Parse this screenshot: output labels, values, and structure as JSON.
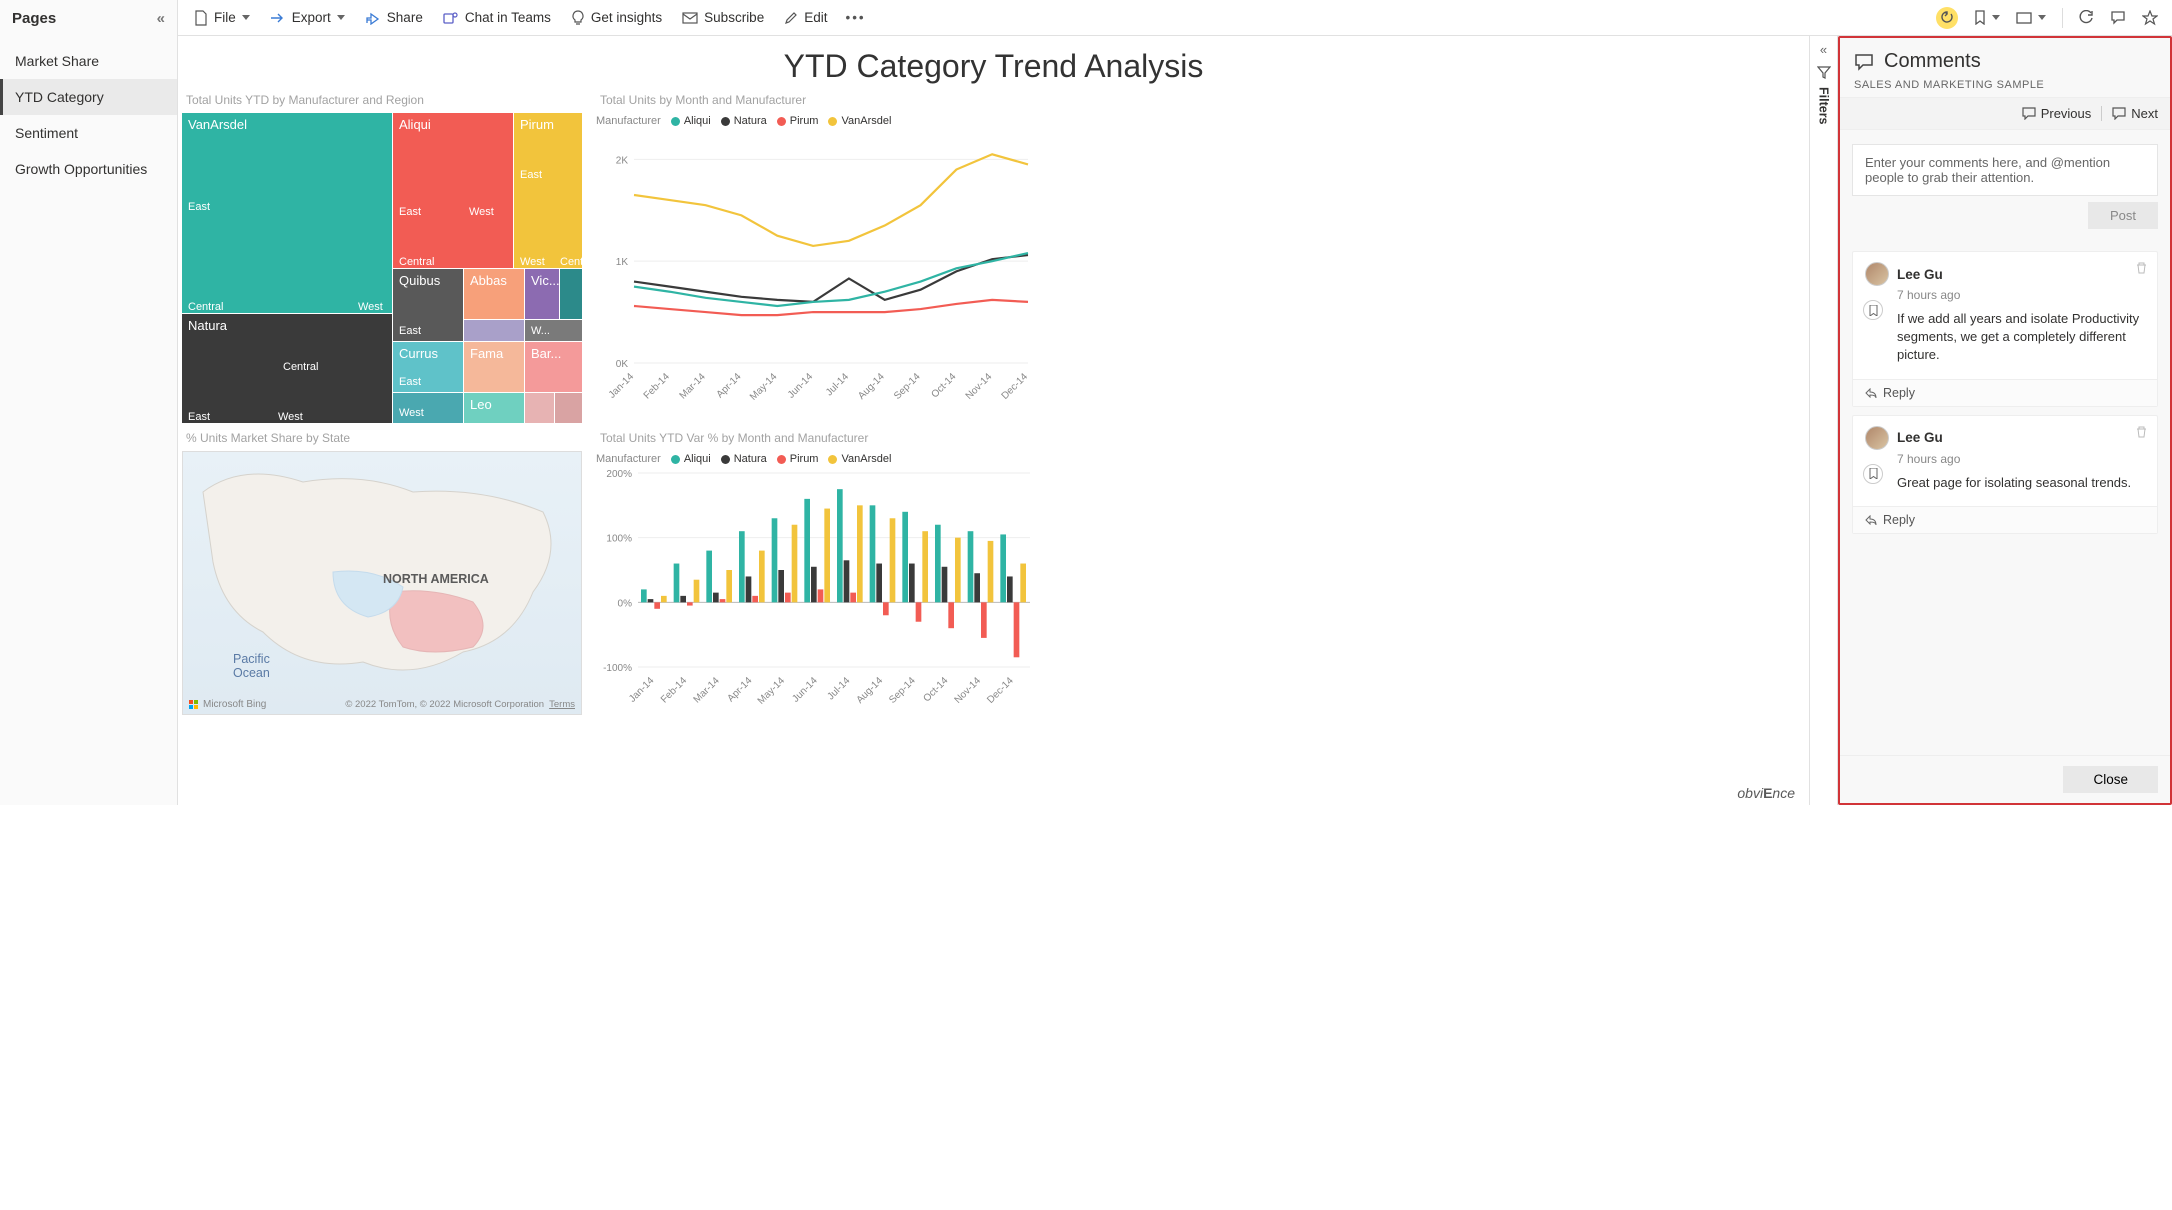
{
  "sidebar": {
    "title": "Pages",
    "items": [
      {
        "label": "Market Share"
      },
      {
        "label": "YTD Category"
      },
      {
        "label": "Sentiment"
      },
      {
        "label": "Growth Opportunities"
      }
    ],
    "active_index": 1
  },
  "toolbar": {
    "file": "File",
    "export": "Export",
    "share": "Share",
    "chat": "Chat in Teams",
    "insights": "Get insights",
    "subscribe": "Subscribe",
    "edit": "Edit"
  },
  "report": {
    "title": "YTD Category Trend Analysis",
    "filters_label": "Filters",
    "brand": "obviEnce",
    "treemap": {
      "title": "Total Units YTD by Manufacturer and Region"
    },
    "line": {
      "title": "Total Units by Month and Manufacturer",
      "legend_label": "Manufacturer"
    },
    "map": {
      "title": "% Units Market Share by State",
      "na_label": "NORTH AMERICA",
      "pacific_label": "Pacific\nOcean",
      "bing": "Microsoft Bing",
      "credits": "© 2022 TomTom, © 2022 Microsoft Corporation",
      "terms": "Terms"
    },
    "bar": {
      "title": "Total Units YTD Var % by Month and Manufacturer",
      "legend_label": "Manufacturer"
    }
  },
  "legend_items": [
    {
      "name": "Aliqui",
      "color": "#2fb4a4"
    },
    {
      "name": "Natura",
      "color": "#3a3a3a"
    },
    {
      "name": "Pirum",
      "color": "#f25c54"
    },
    {
      "name": "VanArsdel",
      "color": "#f2c43c"
    }
  ],
  "comments": {
    "heading": "Comments",
    "subtitle": "SALES AND MARKETING SAMPLE",
    "prev": "Previous",
    "next": "Next",
    "placeholder": "Enter your comments here, and @mention people to grab their attention.",
    "post": "Post",
    "reply": "Reply",
    "close": "Close",
    "items": [
      {
        "user": "Lee Gu",
        "time": "7 hours ago",
        "text": "If we add all years and isolate Productivity segments, we get a completely different picture."
      },
      {
        "user": "Lee Gu",
        "time": "7 hours ago",
        "text": "Great page for isolating seasonal trends."
      }
    ]
  },
  "chart_data": [
    {
      "type": "treemap",
      "title": "Total Units YTD by Manufacturer and Region",
      "nodes": [
        {
          "name": "VanArsdel",
          "color": "#2fb4a4",
          "children": [
            {
              "name": "East",
              "v": 40
            },
            {
              "name": "Central",
              "v": 30
            },
            {
              "name": "West",
              "v": 10
            }
          ]
        },
        {
          "name": "Natura",
          "color": "#3a3a3a",
          "children": [
            {
              "name": "Central",
              "v": 18
            },
            {
              "name": "East",
              "v": 12
            },
            {
              "name": "West",
              "v": 10
            }
          ]
        },
        {
          "name": "Aliqui",
          "color": "#f25c54",
          "children": [
            {
              "name": "East",
              "v": 20
            },
            {
              "name": "West",
              "v": 10
            },
            {
              "name": "Central",
              "v": 14
            }
          ]
        },
        {
          "name": "Pirum",
          "color": "#f2c43c",
          "children": [
            {
              "name": "East",
              "v": 14
            },
            {
              "name": "West",
              "v": 6
            },
            {
              "name": "Cent...",
              "v": 5
            }
          ]
        },
        {
          "name": "Quibus",
          "color": "#595959",
          "children": [
            {
              "name": "East",
              "v": 10
            }
          ]
        },
        {
          "name": "Abbas",
          "color": "#f7a07a",
          "children": [
            {
              "name": "",
              "v": 8
            }
          ]
        },
        {
          "name": "Vic...",
          "color": "#8c6bb1",
          "children": [
            {
              "name": "",
              "v": 5
            }
          ]
        },
        {
          "name": "Currus",
          "color": "#5fc2c9",
          "children": [
            {
              "name": "East",
              "v": 7
            },
            {
              "name": "West",
              "v": 5
            }
          ]
        },
        {
          "name": "Fama",
          "color": "#f5b89a",
          "children": [
            {
              "name": "",
              "v": 6
            }
          ]
        },
        {
          "name": "Bar...",
          "color": "#f49a9a",
          "children": [
            {
              "name": "",
              "v": 5
            }
          ]
        },
        {
          "name": "Leo",
          "color": "#6fd0c0",
          "children": [
            {
              "name": "",
              "v": 5
            }
          ]
        },
        {
          "name": "",
          "color": "#2c8a8a",
          "children": [
            {
              "name": "W...",
              "v": 3
            }
          ]
        }
      ]
    },
    {
      "type": "line",
      "title": "Total Units by Month and Manufacturer",
      "xlabel": "",
      "ylabel": "",
      "ylim": [
        0,
        2200
      ],
      "yticks": [
        0,
        1000,
        2000
      ],
      "ytick_labels": [
        "0K",
        "1K",
        "2K"
      ],
      "categories": [
        "Jan-14",
        "Feb-14",
        "Mar-14",
        "Apr-14",
        "May-14",
        "Jun-14",
        "Jul-14",
        "Aug-14",
        "Sep-14",
        "Oct-14",
        "Nov-14",
        "Dec-14"
      ],
      "series": [
        {
          "name": "VanArsdel",
          "color": "#f2c43c",
          "values": [
            1650,
            1600,
            1550,
            1450,
            1250,
            1150,
            1200,
            1350,
            1550,
            1900,
            2050,
            1950
          ]
        },
        {
          "name": "Natura",
          "color": "#3a3a3a",
          "values": [
            800,
            750,
            700,
            650,
            620,
            600,
            830,
            620,
            720,
            900,
            1020,
            1060
          ]
        },
        {
          "name": "Aliqui",
          "color": "#2fb4a4",
          "values": [
            750,
            700,
            640,
            600,
            560,
            600,
            620,
            700,
            800,
            930,
            1000,
            1080
          ]
        },
        {
          "name": "Pirum",
          "color": "#f25c54",
          "values": [
            560,
            530,
            500,
            470,
            470,
            500,
            500,
            500,
            530,
            580,
            620,
            600
          ]
        }
      ]
    },
    {
      "type": "bar",
      "title": "Total Units YTD Var % by Month and Manufacturer",
      "xlabel": "",
      "ylabel": "",
      "ylim": [
        -100,
        200
      ],
      "yticks": [
        -100,
        0,
        100,
        200
      ],
      "ytick_labels": [
        "-100%",
        "0%",
        "100%",
        "200%"
      ],
      "categories": [
        "Jan-14",
        "Feb-14",
        "Mar-14",
        "Apr-14",
        "May-14",
        "Jun-14",
        "Jul-14",
        "Aug-14",
        "Sep-14",
        "Oct-14",
        "Nov-14",
        "Dec-14"
      ],
      "series": [
        {
          "name": "Aliqui",
          "color": "#2fb4a4",
          "values": [
            20,
            60,
            80,
            110,
            130,
            160,
            175,
            150,
            140,
            120,
            110,
            105
          ]
        },
        {
          "name": "Natura",
          "color": "#3a3a3a",
          "values": [
            5,
            10,
            15,
            40,
            50,
            55,
            65,
            60,
            60,
            55,
            45,
            40
          ]
        },
        {
          "name": "Pirum",
          "color": "#f25c54",
          "values": [
            -10,
            -5,
            5,
            10,
            15,
            20,
            15,
            -20,
            -30,
            -40,
            -55,
            -85
          ]
        },
        {
          "name": "VanArsdel",
          "color": "#f2c43c",
          "values": [
            10,
            35,
            50,
            80,
            120,
            145,
            150,
            130,
            110,
            100,
            95,
            60
          ]
        }
      ]
    }
  ]
}
